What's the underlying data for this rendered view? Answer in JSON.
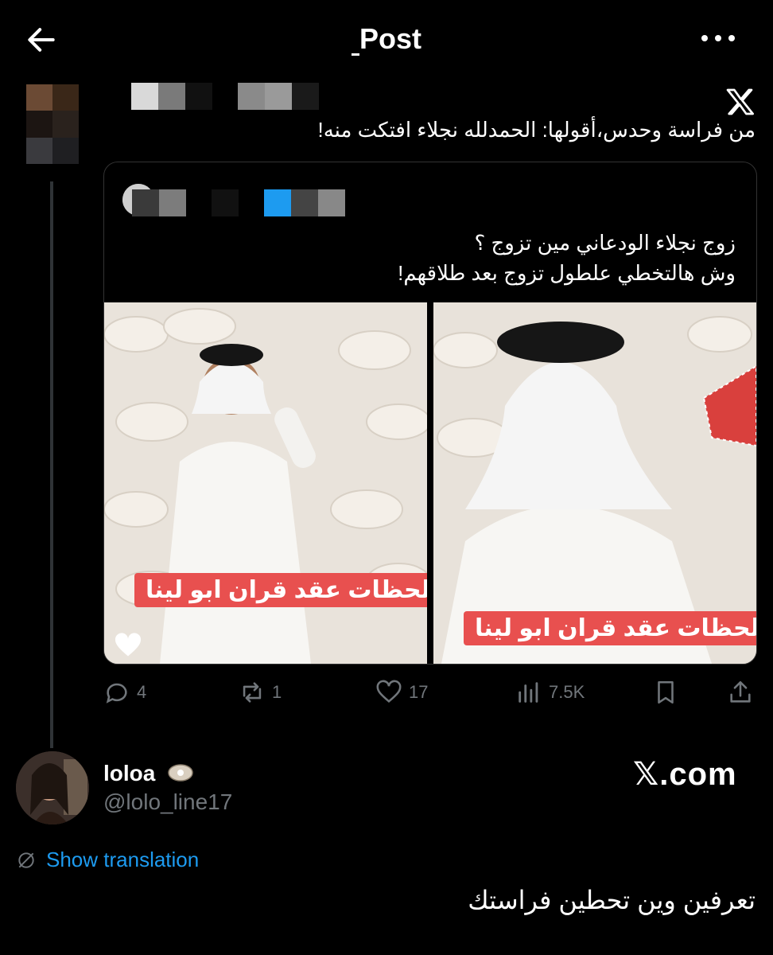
{
  "header": {
    "title": "Post",
    "back_icon": "arrow-left-icon",
    "more_icon": "more-horizontal-icon"
  },
  "main_tweet": {
    "text": "من فراسة وحدس،أقولها: الحمدلله نجلاء افتكت منه!",
    "logo_icon": "x-logo-icon"
  },
  "quoted_tweet": {
    "text_line1": "زوج نجلاء الودعاني مين تزوج ؟",
    "text_line2": "وش هالتخطي علطول تزوج بعد طلاقهم!",
    "image_left_caption": "لحظات عقد قران ابو لينا",
    "image_right_caption": "لحظات عقد قران ابو لينا"
  },
  "actions": {
    "replies": "4",
    "reposts": "1",
    "likes": "17",
    "views": "7.5K"
  },
  "reply_user": {
    "name": "loloa",
    "handle": "@lolo_line17",
    "site": "𝕏.com",
    "show_translation": "Show translation",
    "text": "تعرفين وين تحطين فراستك"
  },
  "colors": {
    "background": "#000000",
    "link": "#1d9bf0",
    "muted": "#71767b",
    "caption_bg": "#e8504f"
  }
}
